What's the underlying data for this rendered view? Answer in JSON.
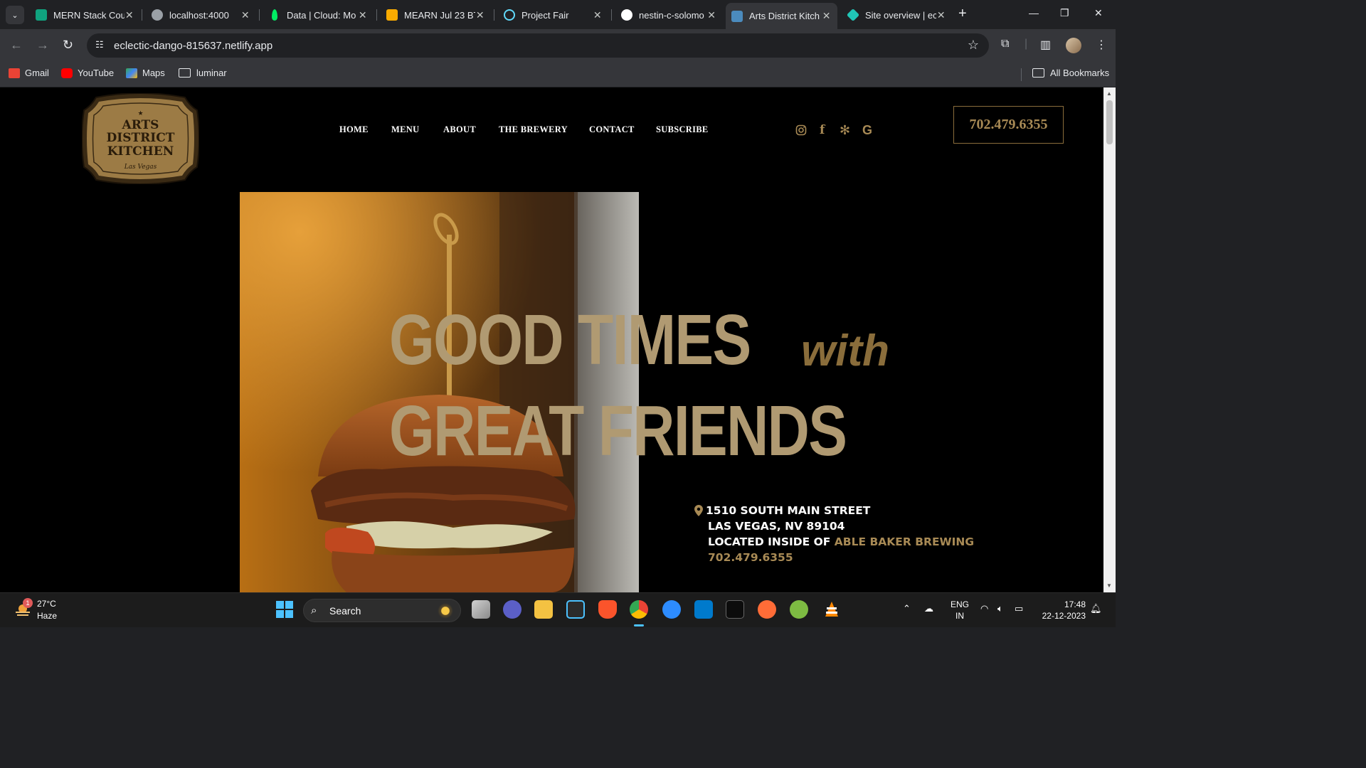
{
  "browser": {
    "tabs": [
      {
        "title": "MERN Stack Cou",
        "favicon_color": "#10a37f",
        "active": false
      },
      {
        "title": "localhost:4000",
        "favicon_color": "#9aa0a6",
        "active": false
      },
      {
        "title": "Data | Cloud: Mo",
        "favicon_color": "#00ed64",
        "active": false
      },
      {
        "title": "MEARN Jul 23 BT",
        "favicon_color": "#f9ab00",
        "active": false
      },
      {
        "title": "Project Fair",
        "favicon_color": "#61dafb",
        "active": false
      },
      {
        "title": "nestin-c-solomo",
        "favicon_color": "#ffffff",
        "active": false
      },
      {
        "title": "Arts District Kitch",
        "favicon_color": "#4b8bbe",
        "active": true
      },
      {
        "title": "Site overview | ec",
        "favicon_color": "#20c6b7",
        "active": false
      }
    ],
    "url": "eclectic-dango-815637.netlify.app",
    "bookmarks": [
      {
        "label": "Gmail",
        "icon": "gmail-icon",
        "color": "#ea4335"
      },
      {
        "label": "YouTube",
        "icon": "youtube-icon",
        "color": "#ff0000"
      },
      {
        "label": "Maps",
        "icon": "maps-icon",
        "color": "#34a853"
      },
      {
        "label": "luminar",
        "icon": "folder-icon"
      }
    ],
    "all_bookmarks_label": "All Bookmarks"
  },
  "site": {
    "logo": {
      "line1": "ARTS",
      "line2": "DISTRICT",
      "line3": "KITCHEN",
      "script": "Las Vegas"
    },
    "nav": [
      "HOME",
      "MENU",
      "ABOUT",
      "THE BREWERY",
      "CONTACT",
      "SUBSCRIBE"
    ],
    "social_icons": [
      "instagram-icon",
      "facebook-icon",
      "yelp-icon",
      "google-icon"
    ],
    "phone": "702.479.6355",
    "headline": {
      "line1": "GOOD TIMES",
      "with": "with",
      "line2": "GREAT FRIENDS"
    },
    "address": {
      "street": "1510 SOUTH MAIN STREET",
      "city": "LAS VEGAS, NV 89104",
      "located_prefix": "LOCATED INSIDE OF ",
      "located_name": "ABLE BAKER BREWING",
      "phone": "702.479.6355"
    },
    "colors": {
      "gold": "#a88a55",
      "headline": "#b09a72",
      "background": "#000000"
    }
  },
  "taskbar": {
    "weather": {
      "temp": "27°C",
      "condition": "Haze",
      "badge": "1"
    },
    "search_label": "Search",
    "tray": {
      "lang_line1": "ENG",
      "lang_line2": "IN"
    },
    "clock": {
      "time": "17:48",
      "date": "22-12-2023"
    }
  }
}
